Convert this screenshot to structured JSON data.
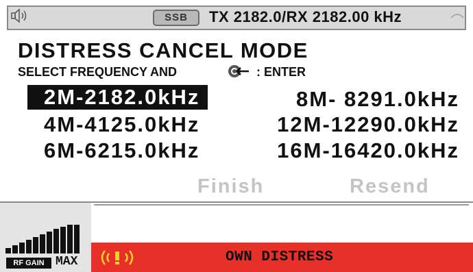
{
  "status_bar": {
    "speaker_icon": "speaker-icon",
    "mode": "SSB",
    "frequency": "TX 2182.0/RX 2182.00 kHz"
  },
  "title": "DISTRESS CANCEL MODE",
  "instruction_prefix": "SELECT FREQUENCY AND",
  "instruction_suffix": ": ENTER",
  "enter_icon": "enter-knob-icon",
  "frequencies": {
    "left": [
      "2M-2182.0kHz",
      "4M-4125.0kHz",
      "6M-6215.0kHz"
    ],
    "right": [
      "8M- 8291.0kHz",
      "12M-12290.0kHz",
      "16M-16420.0kHz"
    ]
  },
  "selected_frequency": "2M-2182.0kHz",
  "buttons": {
    "finish": "Finish",
    "resend": "Resend"
  },
  "rf_gain": {
    "label": "RF GAIN",
    "level": "MAX"
  },
  "alarm": {
    "icon": "distress-alarm-icon",
    "text": "OWN DISTRESS",
    "color": "#e8302a"
  }
}
